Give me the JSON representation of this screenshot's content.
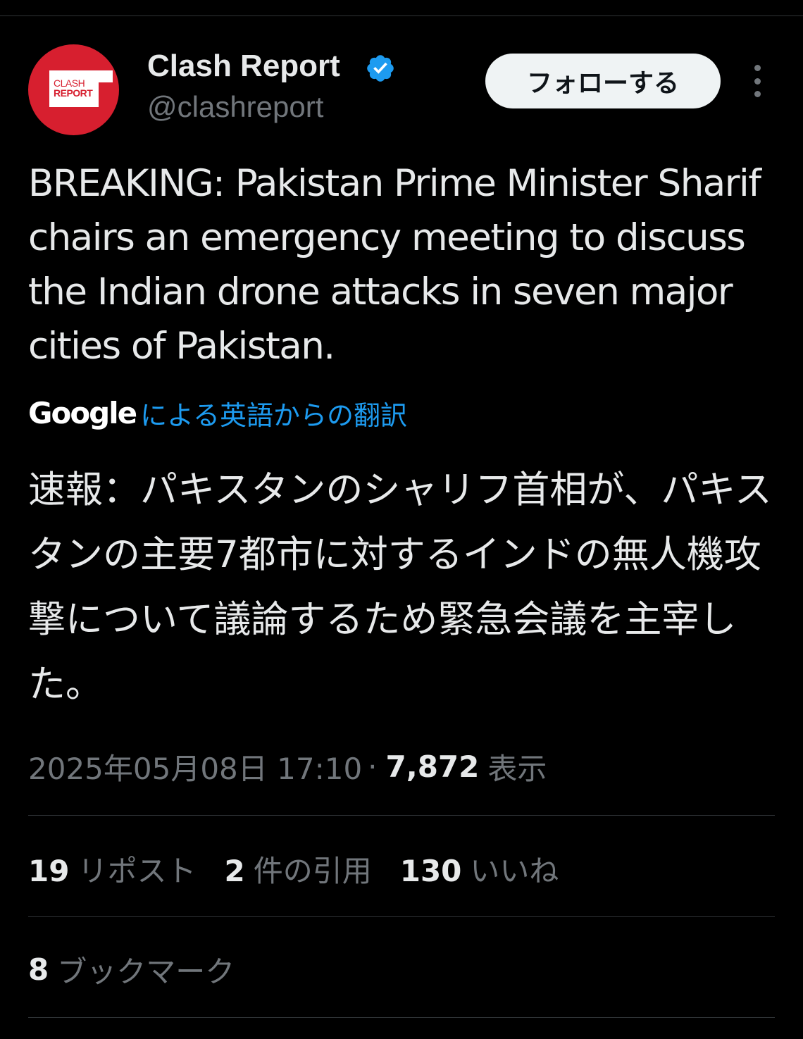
{
  "author": {
    "avatar_text_top": "CLASH",
    "avatar_text_bottom": "REPORT",
    "display_name": "Clash Report",
    "handle": "@clashreport",
    "verified_icon": "verified-badge-icon",
    "accent_color": "#d71f2f"
  },
  "actions": {
    "follow_label": "フォローする",
    "more_icon": "more-vertical-icon"
  },
  "tweet": {
    "text": "BREAKING: Pakistan Prime Minister Sharif chairs an emergency meeting to discuss the Indian drone attacks in seven major cities of Pakistan.",
    "translation_provider": "Google",
    "translation_link": "による英語からの翻訳",
    "translated_text": "速報：パキスタンのシャリフ首相が、パキスタンの主要7都市に対するインドの無人機攻撃について議論するため緊急会議を主宰した。"
  },
  "meta": {
    "timestamp": "2025年05月08日 17:10",
    "separator": "·",
    "views_count": "7,872",
    "views_label": "表示"
  },
  "stats": {
    "reposts_count": "19",
    "reposts_label": "リポスト",
    "quotes_count": "2",
    "quotes_label": "件の引用",
    "likes_count": "130",
    "likes_label": "いいね",
    "bookmarks_count": "8",
    "bookmarks_label": "ブックマーク"
  },
  "colors": {
    "background": "#000000",
    "primary_text": "#e7e9ea",
    "secondary_text": "#71767b",
    "link": "#1d9bf0",
    "divider": "#2f3336",
    "verified": "#1d9bf0"
  }
}
